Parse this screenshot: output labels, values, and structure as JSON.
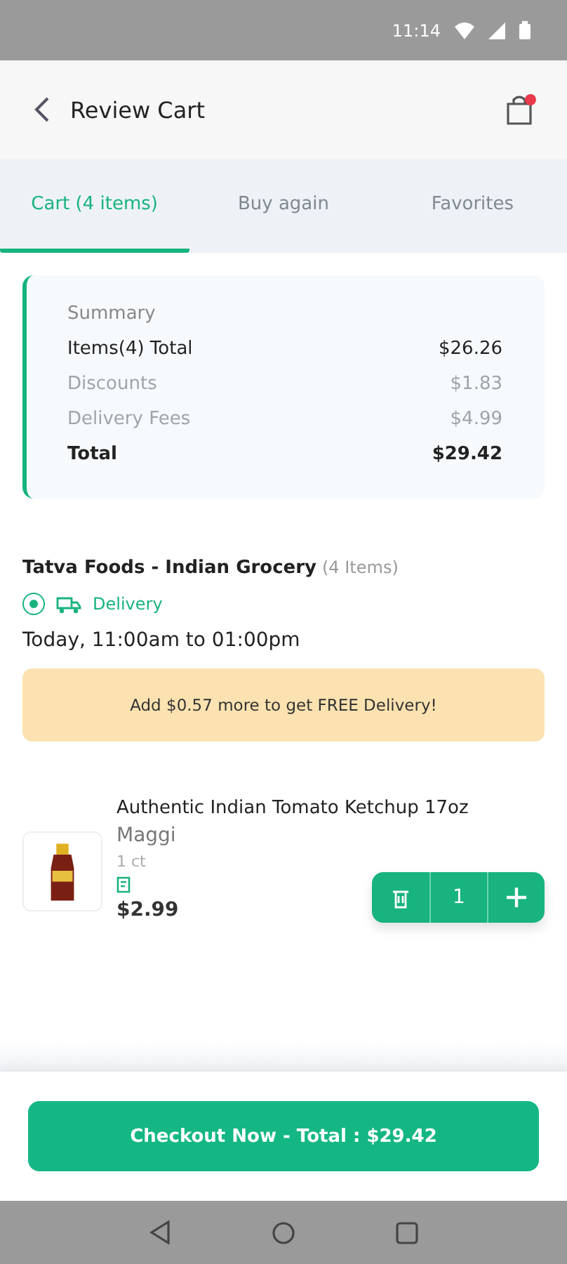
{
  "status_bar": {
    "time": "11:14"
  },
  "header": {
    "title": "Review Cart",
    "cart_badge": true
  },
  "tabs": [
    {
      "label": "Cart (4 items)",
      "selected": true
    },
    {
      "label": "Buy again",
      "selected": false
    },
    {
      "label": "Favorites",
      "selected": false
    }
  ],
  "summary": {
    "title": "Summary",
    "rows": [
      {
        "label": "Items(4) Total",
        "value": "$26.26",
        "kind": "normal"
      },
      {
        "label": "Discounts",
        "value": "$1.83",
        "kind": "muted"
      },
      {
        "label": "Delivery Fees",
        "value": "$4.99",
        "kind": "muted"
      },
      {
        "label": "Total",
        "value": "$29.42",
        "kind": "total"
      }
    ]
  },
  "store": {
    "name": "Tatva Foods - Indian Grocery",
    "count": "(4 Items)",
    "mode": {
      "label": "Delivery",
      "selected": true
    },
    "slot": "Today, 11:00am to 01:00pm"
  },
  "banner": "Add $0.57 more to get FREE Delivery!",
  "products": [
    {
      "kind": "picture",
      "name": "Authentic Indian  Tomato Ketchup 17oz",
      "brand": "Maggi",
      "size": "1 ct",
      "price": "$2.99",
      "quantity": "1"
    }
  ],
  "checkout_button": "Checkout Now - Total : $29.42"
}
